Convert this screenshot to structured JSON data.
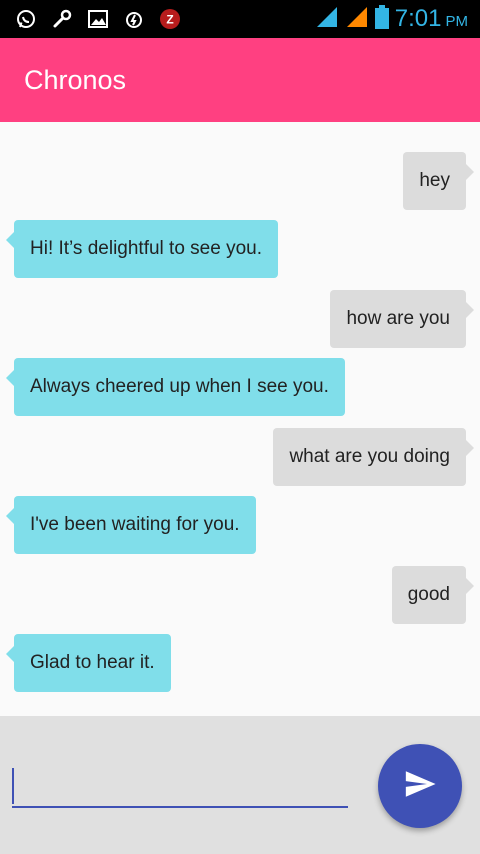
{
  "status_bar": {
    "time": "7:01",
    "ampm": "PM",
    "icons": [
      "whatsapp-icon",
      "wrench-icon",
      "image-icon",
      "charging-icon",
      "notification-icon",
      "signal-icon",
      "signal-icon-2",
      "battery-icon"
    ]
  },
  "app": {
    "title": "Chronos"
  },
  "messages": [
    {
      "from": "user",
      "text": "hey"
    },
    {
      "from": "bot",
      "text": "Hi! It’s delightful to see you."
    },
    {
      "from": "user",
      "text": "how are you"
    },
    {
      "from": "bot",
      "text": "Always cheered up when I see you."
    },
    {
      "from": "user",
      "text": "what are you doing"
    },
    {
      "from": "bot",
      "text": "I've been waiting for you."
    },
    {
      "from": "user",
      "text": "good"
    },
    {
      "from": "bot",
      "text": "Glad to hear it."
    }
  ],
  "composer": {
    "value": "",
    "send_icon": "send-icon"
  },
  "colors": {
    "accent": "#ff4081",
    "primary": "#3f51b5",
    "bot_bubble": "#80deea",
    "user_bubble": "#dcdcdc"
  }
}
